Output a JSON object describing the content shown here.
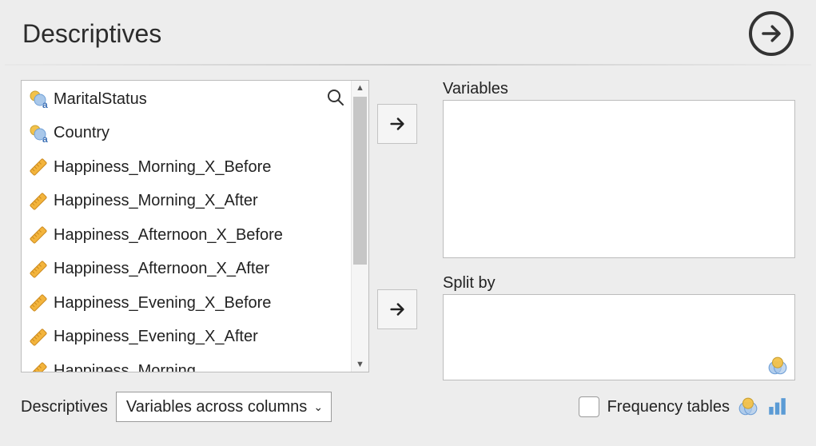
{
  "title": "Descriptives",
  "variables": [
    {
      "name": "MaritalStatus",
      "type": "nominal-text"
    },
    {
      "name": "Country",
      "type": "nominal-text"
    },
    {
      "name": "Happiness_Morning_X_Before",
      "type": "scale"
    },
    {
      "name": "Happiness_Morning_X_After",
      "type": "scale"
    },
    {
      "name": "Happiness_Afternoon_X_Before",
      "type": "scale"
    },
    {
      "name": "Happiness_Afternoon_X_After",
      "type": "scale"
    },
    {
      "name": "Happiness_Evening_X_Before",
      "type": "scale"
    },
    {
      "name": "Happiness_Evening_X_After",
      "type": "scale"
    },
    {
      "name": "Happiness_Morning",
      "type": "scale"
    }
  ],
  "targets": {
    "variables_label": "Variables",
    "split_label": "Split by"
  },
  "footer": {
    "label": "Descriptives",
    "select_value": "Variables across columns",
    "freq_label": "Frequency tables",
    "freq_checked": false
  },
  "icons": {
    "nominal_text": "nominal-text-icon",
    "scale": "ruler-icon",
    "search": "search-icon",
    "run": "arrow-right-icon",
    "move": "arrow-right-icon",
    "venn": "venn-icon",
    "bars": "bars-icon"
  }
}
